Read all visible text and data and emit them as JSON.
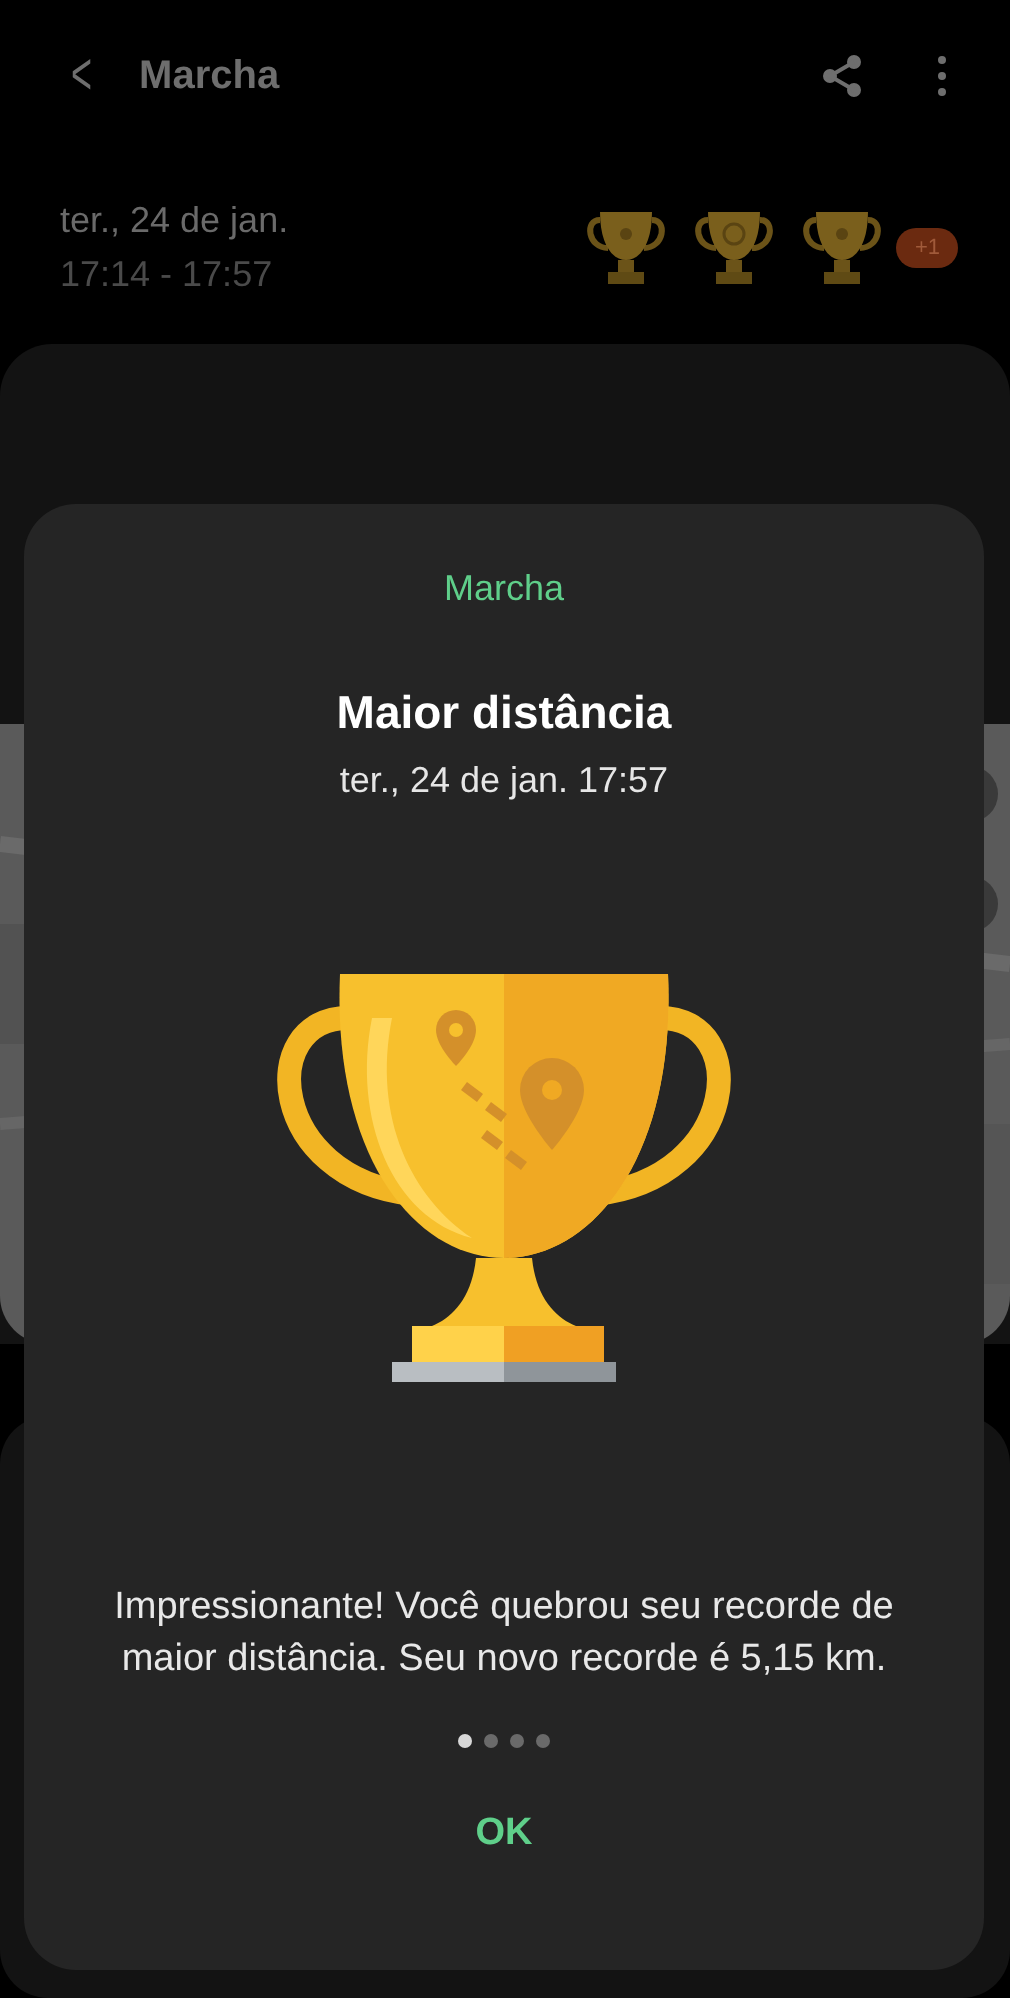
{
  "header": {
    "back": "<",
    "title": "Marcha"
  },
  "session": {
    "date": "ter., 24 de jan.",
    "time_range": "17:14 - 17:57",
    "extra_badge": "+1"
  },
  "dialog": {
    "category": "Marcha",
    "title": "Maior distância",
    "timestamp": "ter., 24 de jan. 17:57",
    "message": "Impressionante! Você quebrou seu recorde de maior distância. Seu novo recorde é 5,15 km.",
    "pages": [
      {
        "selected": true
      },
      {
        "selected": false
      },
      {
        "selected": false
      },
      {
        "selected": false
      }
    ],
    "ok": "OK"
  }
}
